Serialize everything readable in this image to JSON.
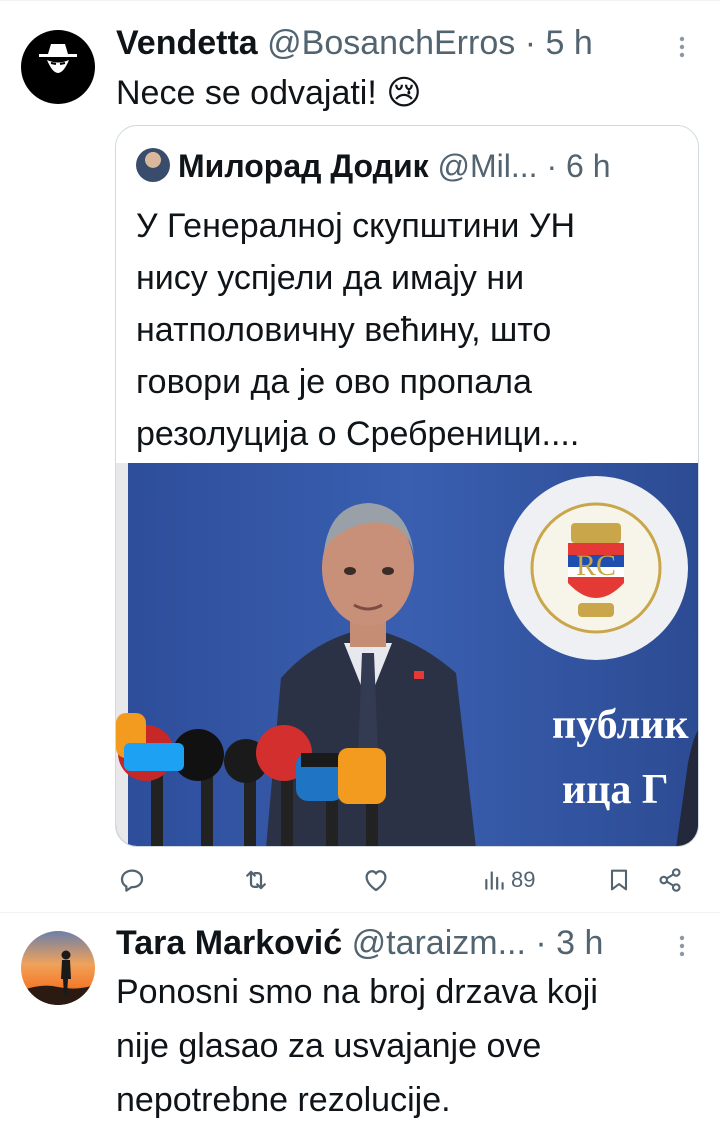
{
  "tweets": [
    {
      "name": "Vendetta",
      "handle": "@BosanchErros",
      "dot": "·",
      "time": "5 h",
      "text": "Nece se odvajati! 😢",
      "quote": {
        "name": "Милорад Додик",
        "handle": "@Mil...",
        "dot": "·",
        "time": "6 h",
        "lines": [
          "У Генералној скупштини УН",
          "нису успјели да имају ни",
          "натполовичну већину, што",
          "говори да је ово пропала",
          "резолуција о Сребреници...."
        ],
        "photo_sign_line1": "публик",
        "photo_sign_line2": "ица Г"
      },
      "actions": {
        "views": "89"
      }
    },
    {
      "name": "Tara Marković",
      "handle": "@taraizm...",
      "dot": "·",
      "time": "3 h",
      "lines": [
        "Ponosni smo na broj drzava koji",
        "nije glasao za usvajanje ove",
        "nepotrebne rezolucije."
      ]
    }
  ],
  "icons": {
    "reply": "reply-icon",
    "retweet": "retweet-icon",
    "like": "like-icon",
    "views": "views-icon",
    "bookmark": "bookmark-icon",
    "share": "share-icon",
    "more": "more-icon"
  },
  "colors": {
    "text": "#0f1419",
    "secondary": "#536471",
    "border": "#cfd9de"
  }
}
